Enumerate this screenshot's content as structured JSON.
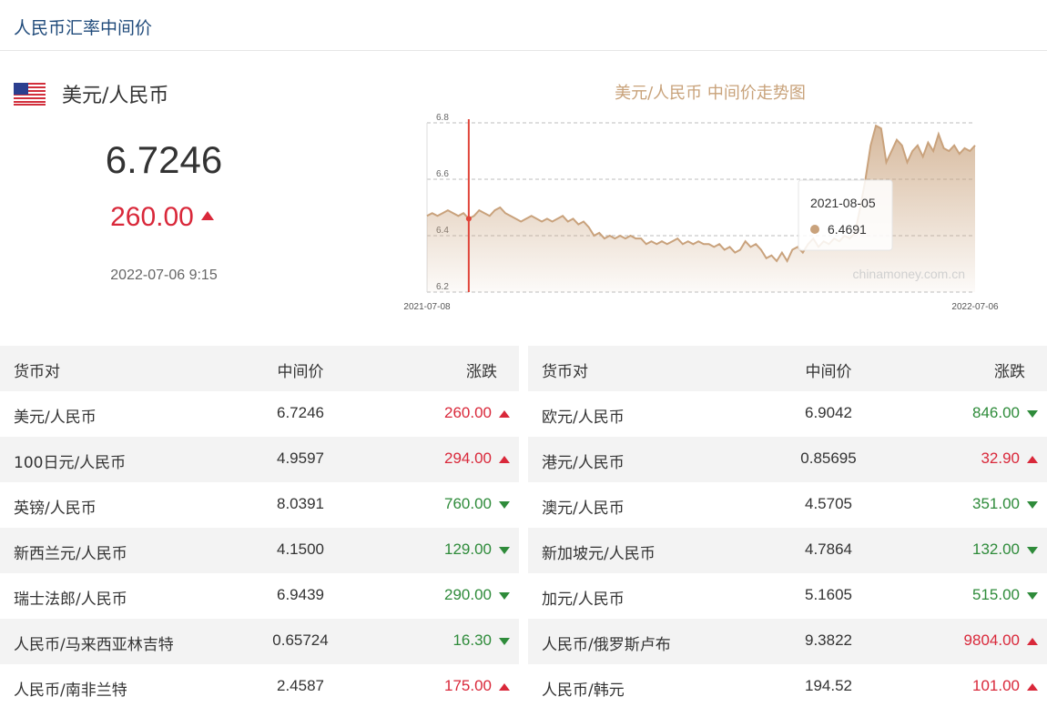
{
  "page": {
    "title": "人民币汇率中间价"
  },
  "summary": {
    "pair": "美元/人民币",
    "rate": "6.7246",
    "change": "260.00",
    "direction": "up",
    "time": "2022-07-06 9:15"
  },
  "chart_data": {
    "type": "area",
    "title": "美元/人民币 中间价走势图",
    "x_start": "2021-07-08",
    "x_end": "2022-07-06",
    "ylim": [
      6.2,
      6.8
    ],
    "yticks": [
      "6.8",
      "6.6",
      "6.4",
      "6.2"
    ],
    "grid": true,
    "watermark": "chinamoney.com.cn",
    "tooltip": {
      "date": "2021-08-05",
      "value": "6.4691"
    },
    "values": [
      6.47,
      6.48,
      6.47,
      6.48,
      6.49,
      6.48,
      6.47,
      6.48,
      6.46,
      6.47,
      6.49,
      6.48,
      6.47,
      6.49,
      6.5,
      6.48,
      6.47,
      6.46,
      6.45,
      6.46,
      6.47,
      6.46,
      6.45,
      6.46,
      6.45,
      6.46,
      6.47,
      6.45,
      6.46,
      6.44,
      6.45,
      6.43,
      6.4,
      6.41,
      6.39,
      6.4,
      6.39,
      6.4,
      6.39,
      6.4,
      6.39,
      6.39,
      6.37,
      6.38,
      6.37,
      6.38,
      6.37,
      6.38,
      6.39,
      6.37,
      6.38,
      6.37,
      6.38,
      6.37,
      6.37,
      6.36,
      6.37,
      6.35,
      6.36,
      6.34,
      6.35,
      6.38,
      6.36,
      6.37,
      6.35,
      6.32,
      6.33,
      6.31,
      6.34,
      6.31,
      6.35,
      6.36,
      6.34,
      6.37,
      6.39,
      6.36,
      6.38,
      6.37,
      6.39,
      6.38,
      6.4,
      6.39,
      6.41,
      6.5,
      6.6,
      6.72,
      6.79,
      6.78,
      6.66,
      6.7,
      6.74,
      6.72,
      6.66,
      6.7,
      6.72,
      6.68,
      6.73,
      6.7,
      6.76,
      6.71,
      6.7,
      6.72,
      6.69,
      6.71,
      6.7,
      6.72
    ],
    "cursor_index": 8,
    "colors": {
      "line": "#c9a27c",
      "cursor": "#e0453a",
      "title": "#c8a27a"
    }
  },
  "tables": {
    "headers": {
      "pair": "货币对",
      "mid": "中间价",
      "change": "涨跌"
    },
    "left": [
      {
        "pair": "美元/人民币",
        "mid": "6.7246",
        "change": "260.00",
        "dir": "up"
      },
      {
        "pair": "100日元/人民币",
        "mid": "4.9597",
        "change": "294.00",
        "dir": "up"
      },
      {
        "pair": "英镑/人民币",
        "mid": "8.0391",
        "change": "760.00",
        "dir": "down"
      },
      {
        "pair": "新西兰元/人民币",
        "mid": "4.1500",
        "change": "129.00",
        "dir": "down"
      },
      {
        "pair": "瑞士法郎/人民币",
        "mid": "6.9439",
        "change": "290.00",
        "dir": "down"
      },
      {
        "pair": "人民币/马来西亚林吉特",
        "mid": "0.65724",
        "change": "16.30",
        "dir": "down"
      },
      {
        "pair": "人民币/南非兰特",
        "mid": "2.4587",
        "change": "175.00",
        "dir": "up"
      }
    ],
    "right": [
      {
        "pair": "欧元/人民币",
        "mid": "6.9042",
        "change": "846.00",
        "dir": "down"
      },
      {
        "pair": "港元/人民币",
        "mid": "0.85695",
        "change": "32.90",
        "dir": "up"
      },
      {
        "pair": "澳元/人民币",
        "mid": "4.5705",
        "change": "351.00",
        "dir": "down"
      },
      {
        "pair": "新加坡元/人民币",
        "mid": "4.7864",
        "change": "132.00",
        "dir": "down"
      },
      {
        "pair": "加元/人民币",
        "mid": "5.1605",
        "change": "515.00",
        "dir": "down"
      },
      {
        "pair": "人民币/俄罗斯卢布",
        "mid": "9.3822",
        "change": "9804.00",
        "dir": "up"
      },
      {
        "pair": "人民币/韩元",
        "mid": "194.52",
        "change": "101.00",
        "dir": "up"
      }
    ]
  }
}
